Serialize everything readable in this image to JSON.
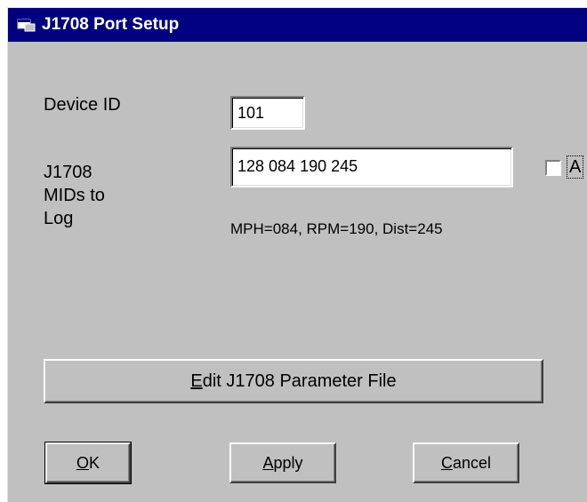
{
  "window": {
    "title": "J1708 Port Setup",
    "icon": "app-window-icon"
  },
  "device_id": {
    "label": "Device ID",
    "value": "101"
  },
  "mids": {
    "label_line1": "J1708",
    "label_line2": "MIDs to",
    "label_line3": "Log",
    "value": "128 084 190 245",
    "description": "MPH=084,  RPM=190, Dist=245",
    "checkbox_label": "A",
    "checkbox_checked": false
  },
  "buttons": {
    "edit_prefix": "",
    "edit_mnemonic": "E",
    "edit_rest": "dit J1708 Parameter File",
    "ok_mnemonic": "O",
    "ok_rest": "K",
    "apply_mnemonic": "A",
    "apply_rest": "pply",
    "cancel_mnemonic": "C",
    "cancel_rest": "ancel"
  },
  "colors": {
    "titlebar": "#000080",
    "face": "#c0c0c0"
  }
}
